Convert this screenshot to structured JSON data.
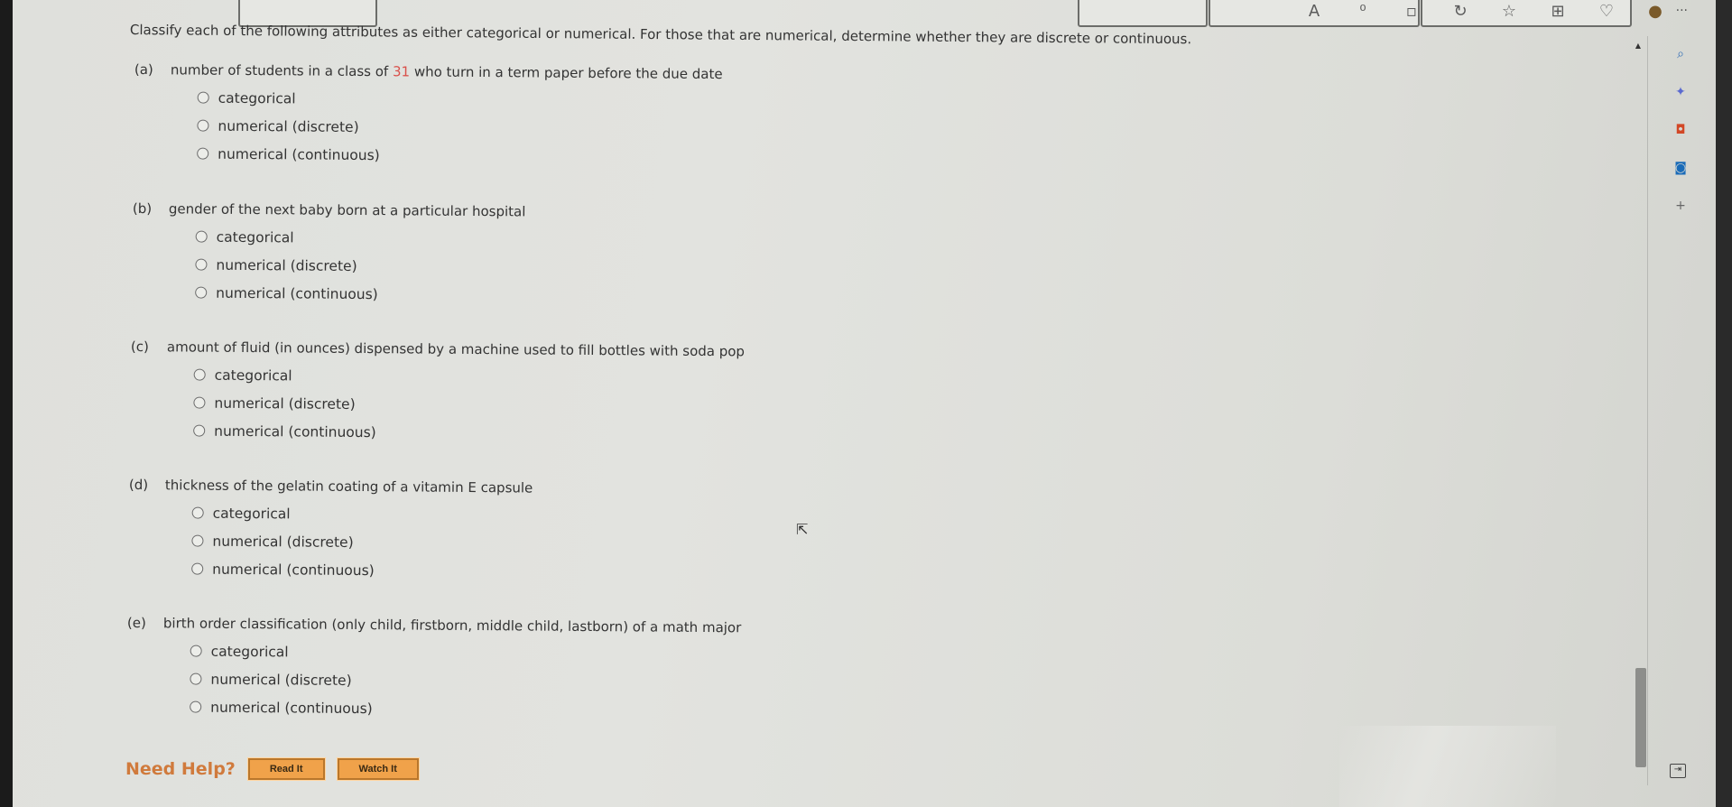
{
  "instructions": "Classify each of the following attributes as either categorical or numerical. For those that are numerical, determine whether they are discrete or continuous.",
  "questions": [
    {
      "letter": "(a)",
      "prompt_before": "number of students in a class of ",
      "highlight": "31",
      "prompt_after": " who turn in a term paper before the due date",
      "options": [
        "categorical",
        "numerical (discrete)",
        "numerical (continuous)"
      ]
    },
    {
      "letter": "(b)",
      "prompt_before": "gender of the next baby born at a particular hospital",
      "highlight": "",
      "prompt_after": "",
      "options": [
        "categorical",
        "numerical (discrete)",
        "numerical (continuous)"
      ]
    },
    {
      "letter": "(c)",
      "prompt_before": "amount of fluid (in ounces) dispensed by a machine used to fill bottles with soda pop",
      "highlight": "",
      "prompt_after": "",
      "options": [
        "categorical",
        "numerical (discrete)",
        "numerical (continuous)"
      ]
    },
    {
      "letter": "(d)",
      "prompt_before": "thickness of the gelatin coating of a vitamin E capsule",
      "highlight": "",
      "prompt_after": "",
      "options": [
        "categorical",
        "numerical (discrete)",
        "numerical (continuous)"
      ]
    },
    {
      "letter": "(e)",
      "prompt_before": "birth order classification (only child, firstborn, middle child, lastborn) of a math major",
      "highlight": "",
      "prompt_after": "",
      "options": [
        "categorical",
        "numerical (discrete)",
        "numerical (continuous)"
      ]
    }
  ],
  "help": {
    "label": "Need Help?",
    "read_it": "Read It",
    "watch_it": "Watch It"
  },
  "icons": {
    "toolbar": [
      "font-size-icon",
      "read-aloud-icon",
      "extensions-icon",
      "refresh-icon",
      "favorites-icon",
      "collections-icon",
      "copilot-icon",
      "profile-icon"
    ],
    "sidebar": [
      "search-icon",
      "sparkle-icon",
      "office-icon",
      "outlook-icon",
      "add-icon"
    ]
  },
  "colors": {
    "highlight_number": "#d9504a",
    "help_label": "#d07a3c",
    "help_button": "#f0a24a"
  }
}
